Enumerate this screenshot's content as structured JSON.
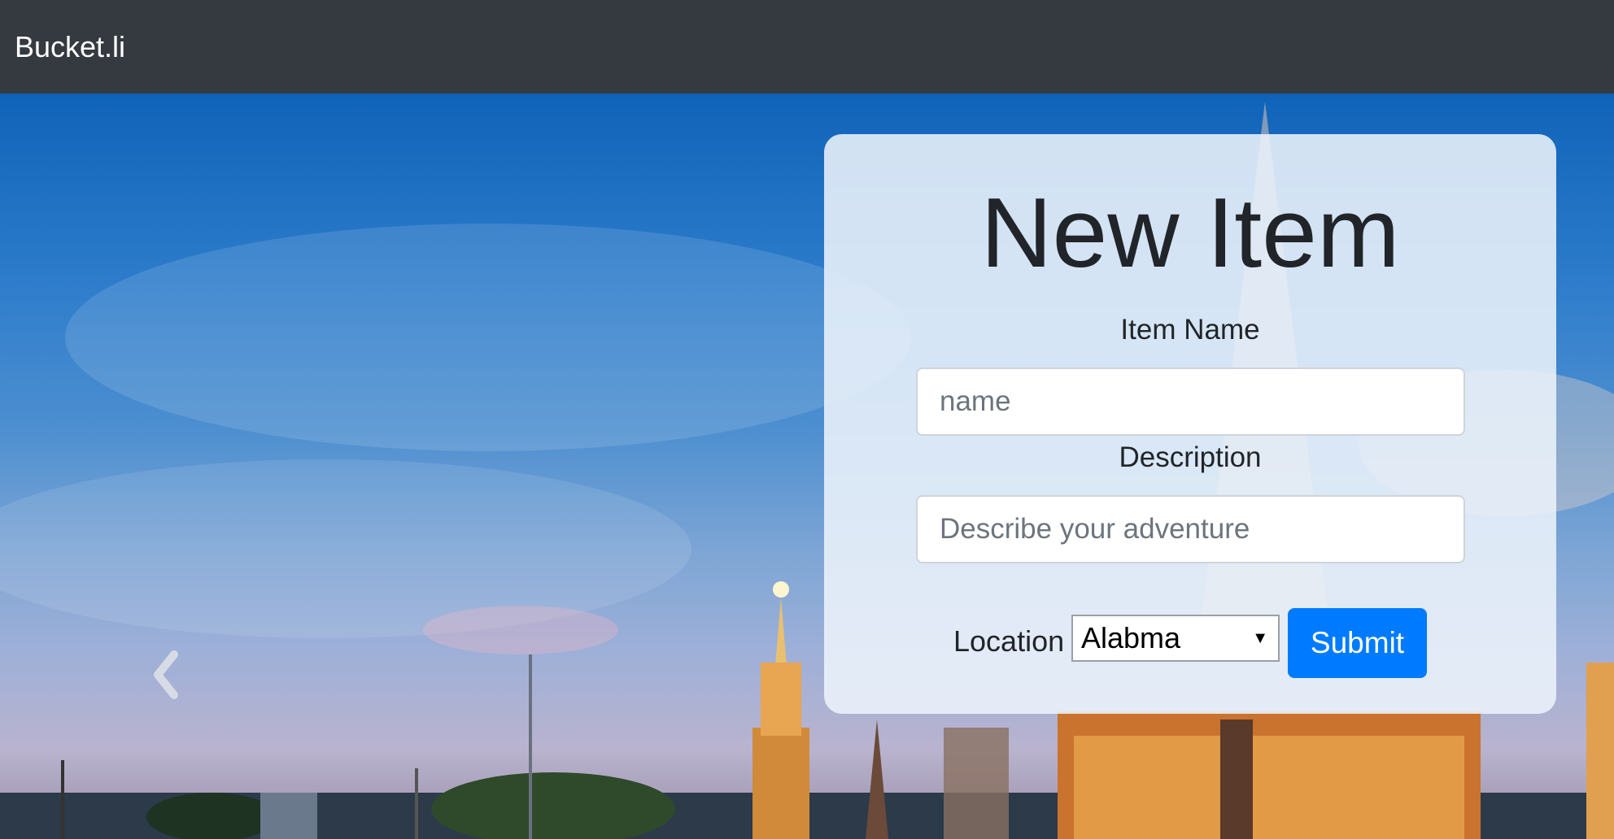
{
  "navbar": {
    "brand": "Bucket.li"
  },
  "form": {
    "title": "New Item",
    "name_label": "Item Name",
    "name_placeholder": "name",
    "description_label": "Description",
    "description_placeholder": "Describe your adventure",
    "location_label": "Location",
    "location_selected": "Alabma",
    "submit_label": "Submit"
  },
  "carousel": {
    "prev_icon": "chevron-left-icon"
  },
  "colors": {
    "navbar_bg": "#343a40",
    "primary": "#007bff",
    "text": "#212529"
  }
}
